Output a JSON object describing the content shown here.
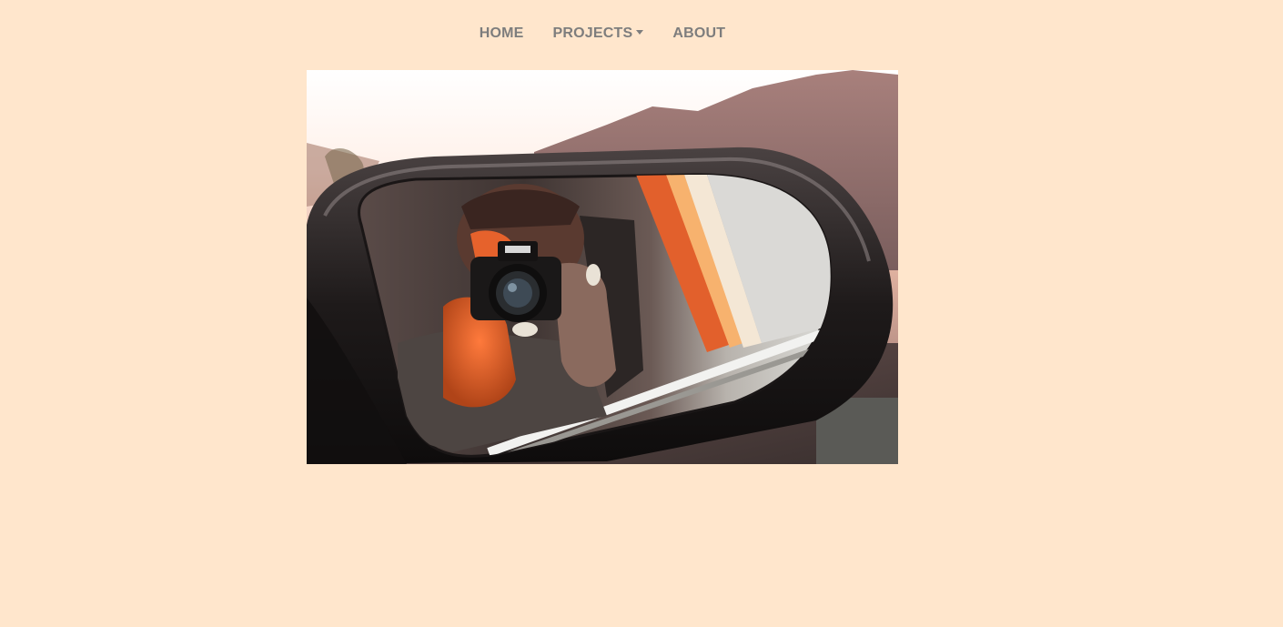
{
  "colors": {
    "page_background": "#ffe6cc",
    "nav_text": "#7d7d7d"
  },
  "nav": {
    "items": [
      {
        "label": "HOME",
        "icon": null
      },
      {
        "label": "PROJECTS",
        "icon": "caret-down-icon"
      },
      {
        "label": "ABOUT",
        "icon": null
      }
    ]
  },
  "hero_image": {
    "subject": "photographer-in-car-side-mirror"
  }
}
